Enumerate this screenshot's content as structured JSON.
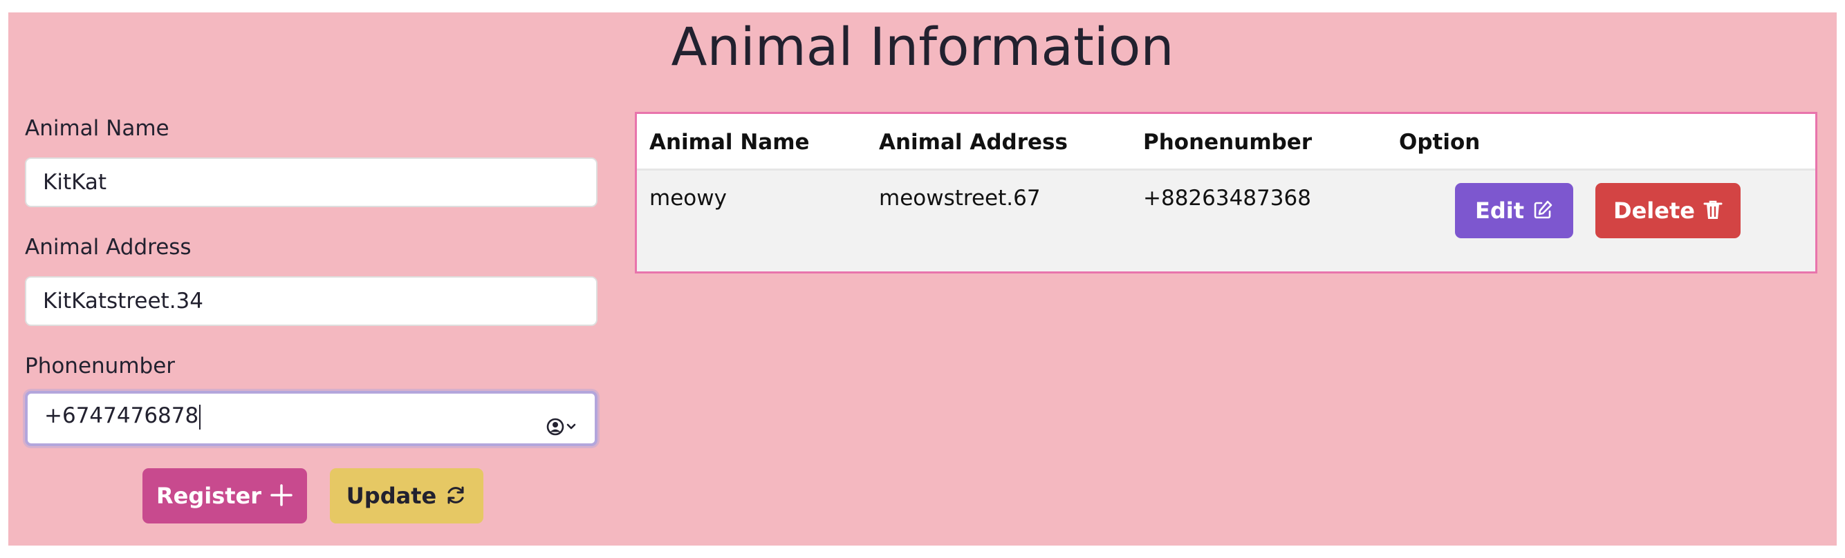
{
  "page": {
    "title": "Animal Information"
  },
  "form": {
    "name_label": "Animal Name",
    "name_value": "KitKat",
    "address_label": "Animal Address",
    "address_value": "KitKatstreet.34",
    "phone_label": "Phonenumber",
    "phone_value": "+6747476878",
    "register_label": "Register",
    "update_label": "Update",
    "register_icon": "plus-icon",
    "update_icon": "refresh-icon",
    "autofill_icon": "user-circle-icon"
  },
  "table": {
    "columns": [
      "Animal Name",
      "Animal Address",
      "Phonenumber",
      "Option"
    ],
    "rows": [
      {
        "name": "meowy",
        "address": "meowstreet.67",
        "phone": "+88263487368",
        "edit_label": "Edit",
        "delete_label": "Delete",
        "edit_icon": "edit-icon",
        "delete_icon": "trash-icon"
      }
    ]
  },
  "colors": {
    "background": "#f4b8c0",
    "table_border": "#e874ac",
    "register": "#c84a8e",
    "update": "#e6c864",
    "edit": "#7d57cf",
    "delete": "#d34444"
  }
}
